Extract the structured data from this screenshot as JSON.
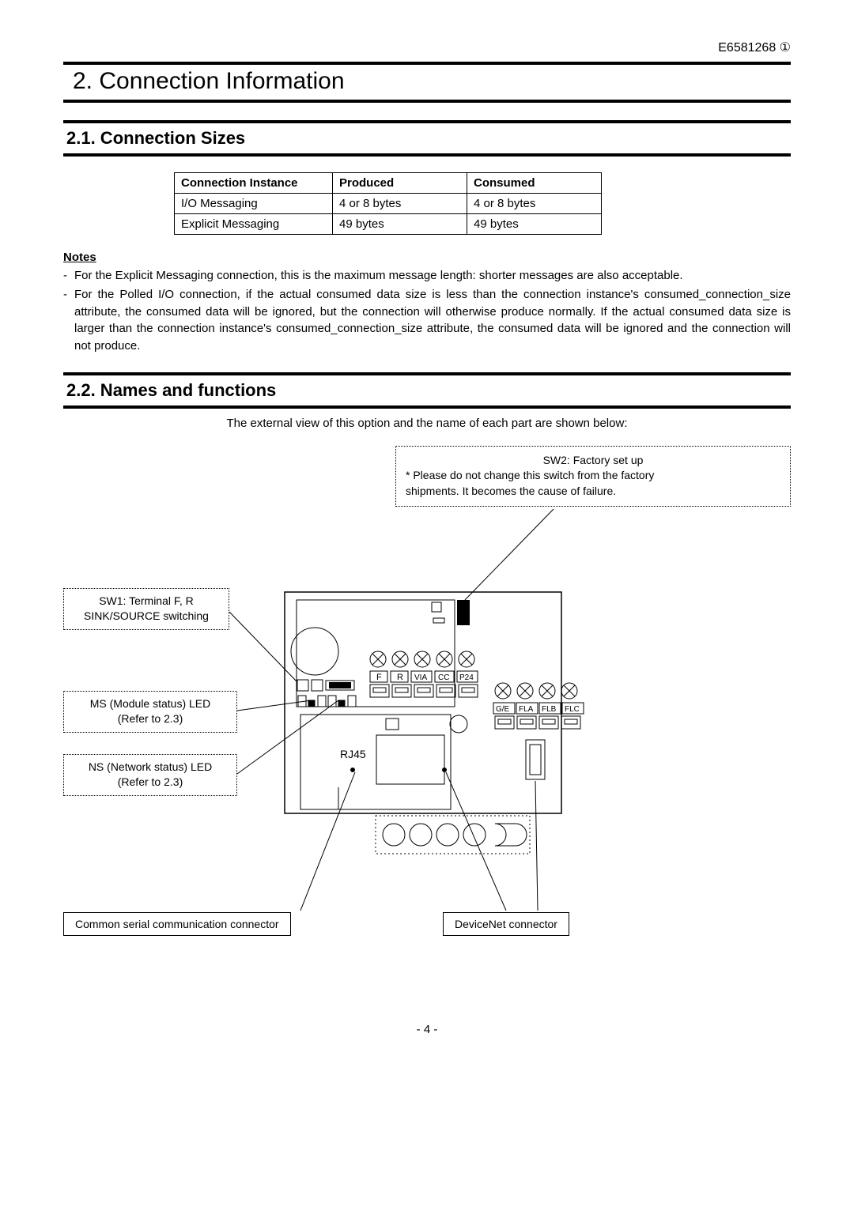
{
  "header": {
    "docnum": "E6581268  ①"
  },
  "chapter": {
    "title": "2. Connection Information"
  },
  "section1": {
    "title": "2.1.   Connection Sizes",
    "table": {
      "headers": [
        "Connection Instance",
        "Produced",
        "Consumed"
      ],
      "rows": [
        [
          "I/O Messaging",
          "4 or 8 bytes",
          "4 or 8 bytes"
        ],
        [
          "Explicit Messaging",
          "49 bytes",
          "49 bytes"
        ]
      ]
    },
    "notes_label": "Notes",
    "notes": [
      "For the Explicit Messaging connection, this is the maximum message length: shorter messages are also acceptable.",
      "For the Polled I/O connection, if the actual consumed data size is less than the connection instance's consumed_connection_size attribute, the consumed data will be ignored, but the connection will otherwise produce normally. If the actual consumed data size is larger than the connection instance's consumed_connection_size attribute, the consumed data will be ignored and the connection will not produce."
    ]
  },
  "section2": {
    "title": "2.2.   Names and functions",
    "intro": "The external view of this option and the name of each part are shown below:"
  },
  "callouts": {
    "sw2_line1": "SW2: Factory set up",
    "sw2_line2": "* Please do not change this switch from the factory",
    "sw2_line3": "  shipments. It becomes the cause of failure.",
    "sw1_line1": "SW1: Terminal F, R",
    "sw1_line2": "SINK/SOURCE switching",
    "ms_line1": "MS (Module status) LED",
    "ms_line2": "(Refer to 2.3)",
    "ns_line1": "NS (Network status) LED",
    "ns_line2": "(Refer to 2.3)",
    "common_conn": "Common serial communication connector",
    "devicenet_conn": "DeviceNet connector",
    "rj45": "RJ45",
    "terms": {
      "f": "F",
      "r": "R",
      "via": "VIA",
      "cc": "CC",
      "p24": "P24",
      "ge": "G/E",
      "fla": "FLA",
      "flb": "FLB",
      "flc": "FLC"
    }
  },
  "pagenum": "- 4 -"
}
